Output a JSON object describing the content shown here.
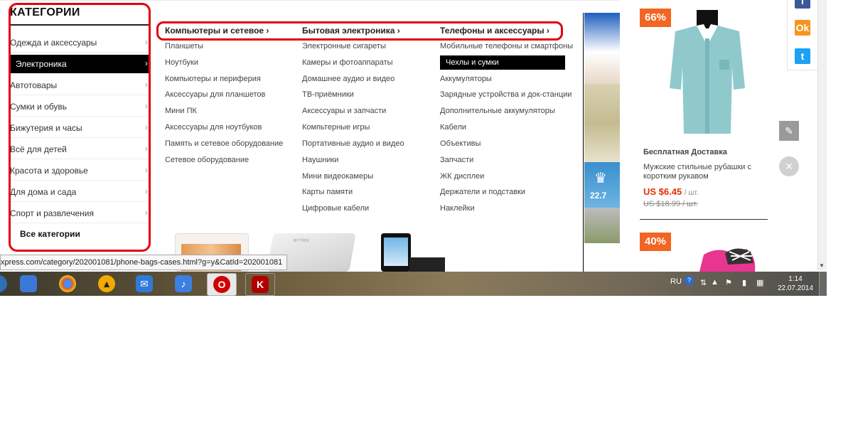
{
  "sidebar": {
    "title": "КАТЕГОРИИ",
    "items": [
      {
        "label": "Одежда и аксессуары",
        "chevron": "›"
      },
      {
        "label": "Электроника",
        "chevron": "›"
      },
      {
        "label": "Автотовары",
        "chevron": "›"
      },
      {
        "label": "Сумки и обувь",
        "chevron": "›"
      },
      {
        "label": "Бижутерия и часы",
        "chevron": "›"
      },
      {
        "label": "Всё для детей",
        "chevron": "›"
      },
      {
        "label": "Красота и здоровье",
        "chevron": "›"
      },
      {
        "label": "Для дома и сада",
        "chevron": "›"
      },
      {
        "label": "Спорт и развлечения",
        "chevron": "›"
      }
    ],
    "all_label": "Все категории"
  },
  "mega_menu": {
    "columns": [
      {
        "heading": "Компьютеры и сетевое ›",
        "links": [
          "Планшеты",
          "Ноутбуки",
          "Компьютеры и периферия",
          "Аксессуары для планшетов",
          "Мини ПК",
          "Аксессуары для ноутбуков",
          "Память и сетевое оборудование",
          "Сетевое оборудование"
        ]
      },
      {
        "heading": "Бытовая электроника ›",
        "links": [
          "Электронные сигареты",
          "Камеры и фотоаппараты",
          "Домашнее аудио и видео",
          "ТВ-приёмники",
          "Аксессуары и запчасти",
          "Компьтерные игры",
          "Портативные аудио и видео",
          "Наушники",
          "Мини видеокамеры",
          "Карты памяти",
          "Цифровые кабели"
        ]
      },
      {
        "heading": "Телефоны и аксессуары ›",
        "links": [
          "Мобильные телефоны и смартфоны",
          "Чехлы и сумки",
          "Аккумуляторы",
          "Зарядные устройства и док-станции",
          "Дополнительные аккумуляторы",
          "Кабели",
          "Объективы",
          "Запчасти",
          "ЖК дисплеи",
          "Держатели и подставки",
          "Наклейки"
        ]
      }
    ],
    "images": {
      "brand_text": "BYTRIX"
    }
  },
  "banner": {
    "number": "22.7"
  },
  "products": [
    {
      "discount": "66%",
      "shipping": "Бесплатная Доставка",
      "title": "Мужские стильные рубашки с коротким рукавом",
      "price": "US $6.45",
      "unit": "/ шт.",
      "old_price": "US $18.99 / шт."
    },
    {
      "discount": "40%"
    }
  ],
  "social": {
    "icons": [
      "facebook-icon",
      "odnoklassniki-icon",
      "twitter-icon"
    ],
    "ok_letter": "Ok",
    "tw_letter": "t"
  },
  "status_url": "xpress.com/category/202001081/phone-bags-cases.html?g=y&CatId=202001081",
  "taskbar": {
    "apps": [
      {
        "icon": "windows-explorer-icon",
        "color": "#3a79d6"
      },
      {
        "icon": "chrome-icon",
        "color": "#4c8bf5"
      },
      {
        "icon": "aimp-icon",
        "color": "#f2a900"
      },
      {
        "icon": "mail-icon",
        "color": "#2f7ad9"
      },
      {
        "icon": "audio-icon",
        "color": "#3b7fe0"
      },
      {
        "icon": "opera-icon",
        "color": "#d00000"
      },
      {
        "icon": "kaspersky-icon",
        "color": "#b00000"
      }
    ],
    "lang": "RU",
    "time": "1:14",
    "date": "22.07.2014"
  },
  "colors": {
    "accent_red": "#e3000f",
    "badge_orange": "#f26522",
    "price_red": "#e62e04"
  }
}
